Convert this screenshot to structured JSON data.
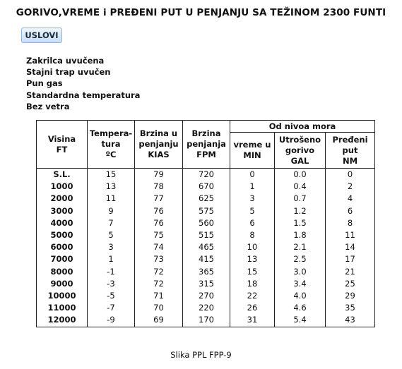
{
  "title": "GORIVO,VREME i PREĐENI PUT U PENJANJU SA TEŽINOM 2300 FUNTI",
  "uslovi_button": "USLOVI",
  "conditions": [
    "Zakrilca uvučena",
    "Stajni trap uvučen",
    "Pun gas",
    "Standardna temperatura",
    "Bez vetra"
  ],
  "table": {
    "group_header": "Od nivoa mora",
    "headers": {
      "altitude": [
        "Visina",
        "FT"
      ],
      "temperature": [
        "Tempera-",
        "tura",
        "ºC"
      ],
      "speed": [
        "Brzina u",
        "penjanju",
        "KIAS"
      ],
      "climb_rate": [
        "Brzina",
        "penjanja",
        "FPM"
      ],
      "time": [
        "vreme u",
        "MIN"
      ],
      "fuel": [
        "Utrošeno",
        "gorivo",
        "GAL"
      ],
      "distance": [
        "Pređeni",
        "put",
        "NM"
      ]
    },
    "rows": [
      [
        "S.L.",
        "15",
        "79",
        "720",
        "0",
        "0.0",
        "0"
      ],
      [
        "1000",
        "13",
        "78",
        "670",
        "1",
        "0.4",
        "2"
      ],
      [
        "2000",
        "11",
        "77",
        "625",
        "3",
        "0.7",
        "4"
      ],
      [
        "3000",
        "9",
        "76",
        "575",
        "5",
        "1.2",
        "6"
      ],
      [
        "4000",
        "7",
        "76",
        "560",
        "6",
        "1.5",
        "8"
      ],
      [
        "5000",
        "5",
        "75",
        "515",
        "8",
        "1.8",
        "11"
      ],
      [
        "6000",
        "3",
        "74",
        "465",
        "10",
        "2.1",
        "14"
      ],
      [
        "7000",
        "1",
        "73",
        "415",
        "13",
        "2.5",
        "17"
      ],
      [
        "8000",
        "-1",
        "72",
        "365",
        "15",
        "3.0",
        "21"
      ],
      [
        "9000",
        "-3",
        "72",
        "315",
        "18",
        "3.4",
        "25"
      ],
      [
        "10000",
        "-5",
        "71",
        "270",
        "22",
        "4.0",
        "29"
      ],
      [
        "11000",
        "-7",
        "70",
        "220",
        "26",
        "4.6",
        "35"
      ],
      [
        "12000",
        "-9",
        "69",
        "170",
        "31",
        "5.4",
        "43"
      ]
    ]
  },
  "caption": "Slika PPL FPP-9"
}
